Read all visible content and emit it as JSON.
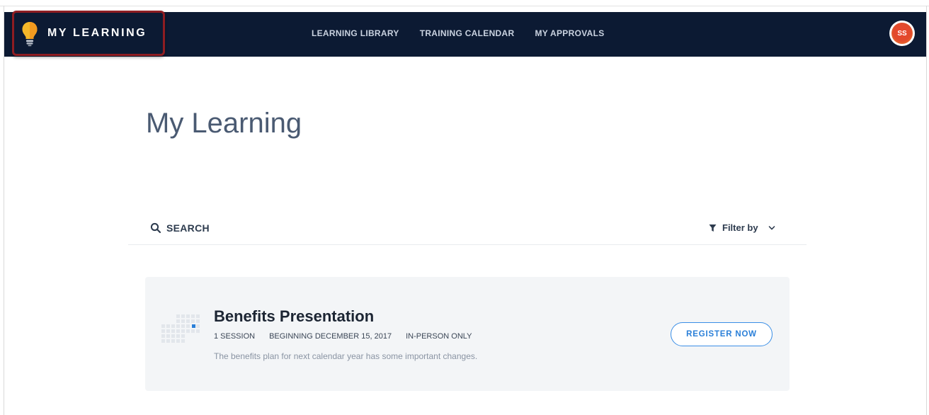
{
  "topbar": {
    "brand_label": "MY LEARNING",
    "nav": [
      {
        "label": "LEARNING LIBRARY"
      },
      {
        "label": "TRAINING CALENDAR"
      },
      {
        "label": "MY APPROVALS"
      }
    ],
    "avatar_initials": "SS",
    "background_color": "#0c1a33",
    "highlight_color": "#8e1d22"
  },
  "main": {
    "page_title": "My Learning",
    "search_label": "SEARCH",
    "filter_label": "Filter by"
  },
  "card": {
    "title": "Benefits Presentation",
    "meta": [
      "1 SESSION",
      "BEGINNING DECEMBER 15, 2017",
      "IN-PERSON ONLY"
    ],
    "description": "The benefits plan for next calendar year has some important changes.",
    "register_label": "REGISTER NOW",
    "accent_color": "#2a7fd8"
  },
  "icons": {
    "brand": "lightbulb-icon",
    "search": "search-icon",
    "filter": "filter-icon",
    "dropdown": "chevron-down-icon",
    "event": "calendar-icon"
  }
}
